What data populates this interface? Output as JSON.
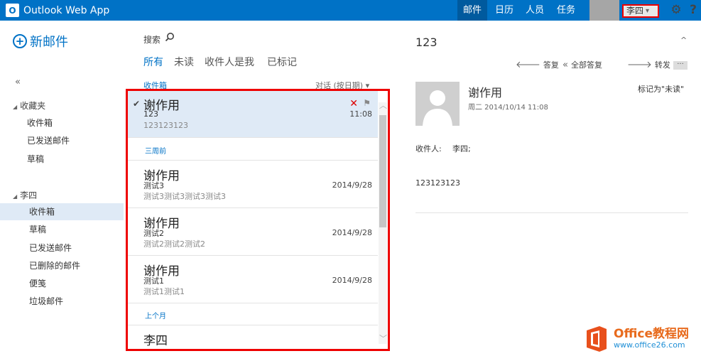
{
  "app": {
    "brand": "Outlook Web App",
    "logo_letter": "O"
  },
  "nav": {
    "mail": "邮件",
    "calendar": "日历",
    "people": "人员",
    "tasks": "任务"
  },
  "user": {
    "name": "李四",
    "caret": "▾"
  },
  "icons": {
    "gear": "⚙",
    "help": "?"
  },
  "left": {
    "new_mail": "新邮件",
    "collapse": "«",
    "favorites": {
      "title": "收藏夹",
      "items": [
        "收件箱",
        "已发送邮件",
        "草稿"
      ]
    },
    "account": {
      "title": "李四",
      "items": [
        "收件箱",
        "草稿",
        "已发送邮件",
        "已删除的邮件",
        "便笺",
        "垃圾邮件"
      ],
      "selected": "收件箱"
    }
  },
  "list": {
    "search_label": "搜索",
    "filters": [
      "所有",
      "未读",
      "收件人是我",
      "已标记"
    ],
    "folder_label": "收件箱",
    "sort_label": "对话 (按日期) ▾",
    "messages": [
      {
        "sender": "谢作用",
        "subject": "123",
        "preview": "123123123",
        "date": "11:08"
      },
      {
        "sender": "谢作用",
        "subject": "测试3",
        "preview": "测试3测试3测试3测试3",
        "date": "2014/9/28"
      },
      {
        "sender": "谢作用",
        "subject": "测试2",
        "preview": "测试2测试2测试2",
        "date": "2014/9/28"
      },
      {
        "sender": "谢作用",
        "subject": "测试1",
        "preview": "测试1测试1",
        "date": "2014/9/28"
      },
      {
        "sender": "李四",
        "subject": "",
        "preview": "",
        "date": ""
      }
    ],
    "groups": [
      "三周前",
      "上个月"
    ]
  },
  "reading": {
    "subject": "123",
    "pane_collapse": "^",
    "actions": {
      "reply": "答复",
      "reply_all": "全部答复",
      "forward": "转发",
      "more": "···"
    },
    "sender": "谢作用",
    "date": "周二 2014/10/14 11:08",
    "mark_as": "标记为\"未读\"",
    "recipients_label": "收件人:",
    "recipients_value": "李四;",
    "body": "123123123"
  },
  "watermark": {
    "line1": "Office教程网",
    "line2": "www.office26.com"
  }
}
